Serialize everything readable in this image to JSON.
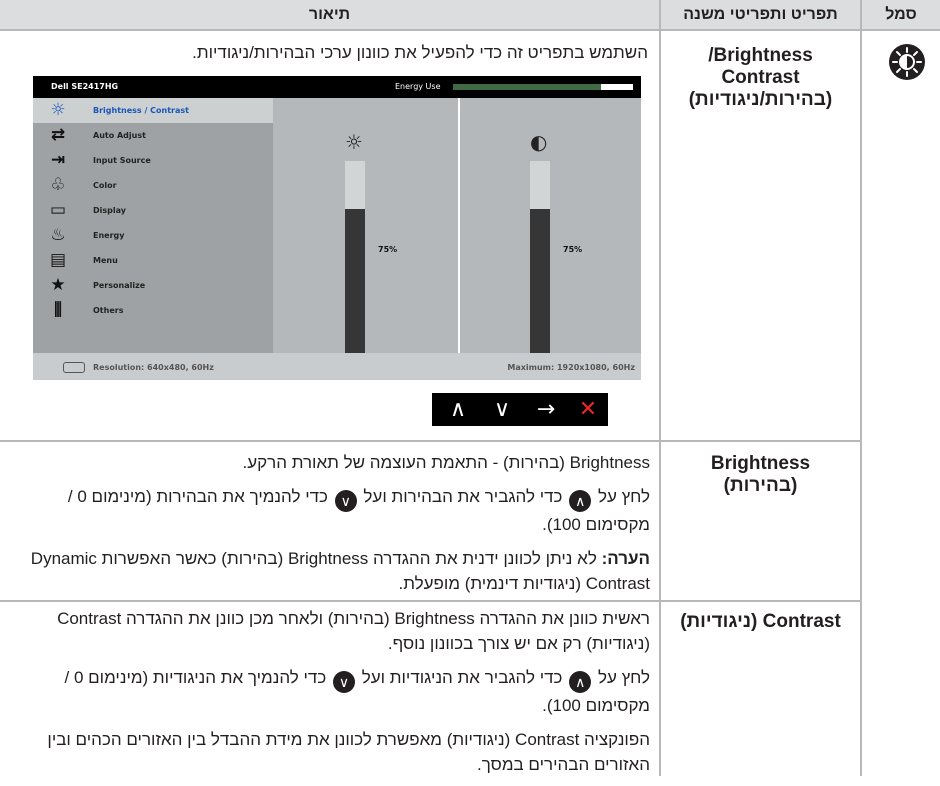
{
  "header": {
    "symbol": "סמל",
    "submenu": "תפריט ותפריטי משנה",
    "description": "תיאור"
  },
  "rows": [
    {
      "submenu_lines": [
        "Brightness/",
        "Contrast",
        "(בהירות/ניגודיות)"
      ],
      "description": "השתמש בתפריט זה כדי להפעיל את כוונון ערכי הבהירות/ניגודיות."
    },
    {
      "submenu_lines": [
        "Brightness",
        "(בהירות)"
      ],
      "p1": "Brightness (בהירות) - התאמת העוצמה של תאורת הרקע.",
      "p2_a": "לחץ על",
      "p2_b": "כדי להגביר את הבהירות ועל",
      "p2_c": "כדי להנמיך את הבהירות (מינימום 0 / מקסימום 100).",
      "note_label": "הערה:",
      "note_text": " לא ניתן לכוונן ידנית את ההגדרה Brightness (בהירות) כאשר האפשרות Dynamic Contrast (ניגודיות דינמית) מופעלת."
    },
    {
      "submenu": "Contrast (ניגודיות)",
      "p1": "ראשית כוונן את ההגדרה Brightness (בהירות) ולאחר מכן כוונן את ההגדרה Contrast (ניגודיות) רק אם יש צורך בכוונון נוסף.",
      "p2_a": "לחץ על",
      "p2_b": "כדי להגביר את הניגודיות ועל",
      "p2_c": "כדי להנמיך את הניגודיות (מינימום 0 / מקסימום 100).",
      "p3": "הפונקציה Contrast (ניגודיות) מאפשרת לכוונן את מידת ההבדל בין האזורים הכהים ובין האזורים הבהירים במסך."
    }
  ],
  "osd": {
    "model": "Dell SE2417HG",
    "energy_label": "Energy Use",
    "energy_level": 0.82,
    "menu": [
      {
        "label": "Brightness / Contrast",
        "icon": "sun-icon",
        "glyph": "☼"
      },
      {
        "label": "Auto Adjust",
        "icon": "auto-adjust-icon",
        "glyph": "⇄"
      },
      {
        "label": "Input Source",
        "icon": "input-source-icon",
        "glyph": "⇥"
      },
      {
        "label": "Color",
        "icon": "color-icon",
        "glyph": "♧"
      },
      {
        "label": "Display",
        "icon": "display-icon",
        "glyph": "▭"
      },
      {
        "label": "Energy",
        "icon": "energy-icon",
        "glyph": "♨"
      },
      {
        "label": "Menu",
        "icon": "menu-icon",
        "glyph": "▤"
      },
      {
        "label": "Personalize",
        "icon": "star-icon",
        "glyph": "★"
      },
      {
        "label": "Others",
        "icon": "others-icon",
        "glyph": "⫼"
      }
    ],
    "brightness_value": 75,
    "brightness_pct": "75%",
    "contrast_value": 75,
    "contrast_pct": "75%",
    "resolution": "Resolution: 640x480, 60Hz",
    "maximum": "Maximum: 1920x1080, 60Hz"
  },
  "nav": {
    "up": "∧",
    "down": "∨",
    "enter": "→",
    "exit": "✕",
    "exit_color": "#e8262b"
  },
  "colors": {
    "header_bg": "#dcdddf",
    "selected_menu": "#1a55b8",
    "energy_fill": "#416944"
  }
}
